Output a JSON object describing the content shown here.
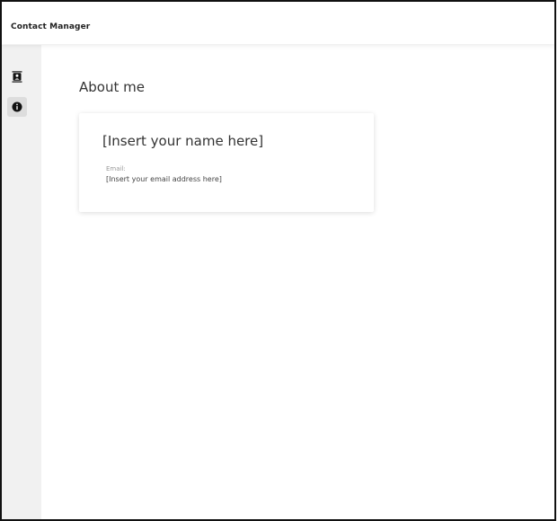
{
  "app": {
    "title": "Contact Manager"
  },
  "sidebar": {
    "items": [
      {
        "icon": "contacts-book-icon",
        "selected": false
      },
      {
        "icon": "info-icon",
        "selected": true
      }
    ]
  },
  "page": {
    "title": "About me"
  },
  "profile_card": {
    "name": "[Insert your name here]",
    "email_label": "Email:",
    "email_value": "[Insert your email address here]"
  }
}
